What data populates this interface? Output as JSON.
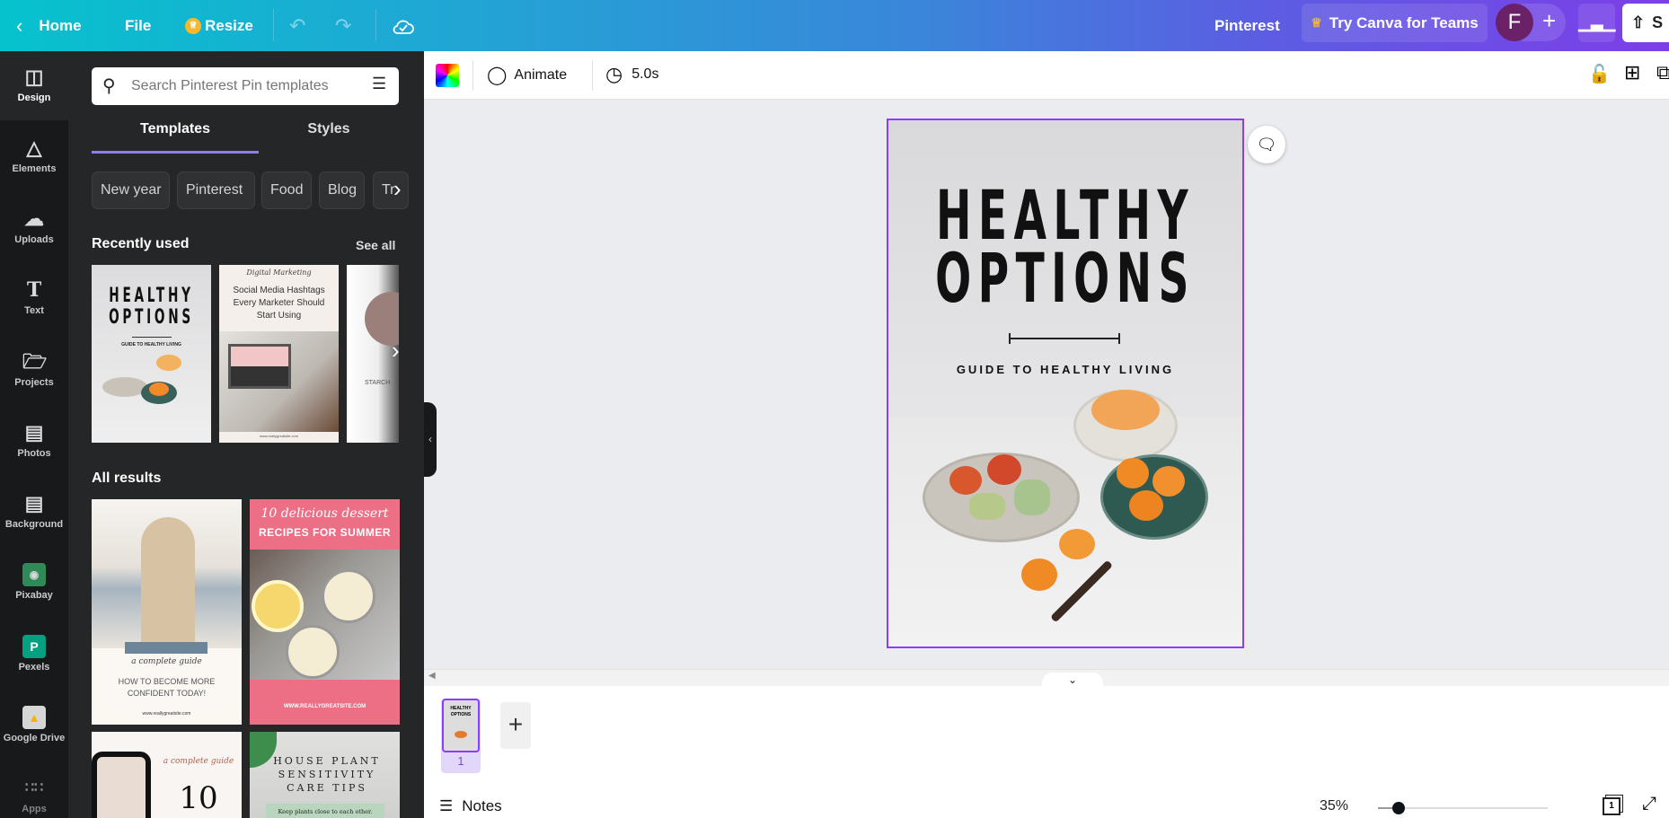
{
  "topbar": {
    "home": "Home",
    "file": "File",
    "resize": "Resize",
    "design_name": "Pinterest",
    "teams": "Try Canva for Teams",
    "avatar": "F",
    "share": "S"
  },
  "rail": [
    {
      "label": "Design",
      "icon": "design-icon"
    },
    {
      "label": "Elements",
      "icon": "elements-icon"
    },
    {
      "label": "Uploads",
      "icon": "upload-cloud-icon"
    },
    {
      "label": "Text",
      "icon": "text-icon"
    },
    {
      "label": "Projects",
      "icon": "folder-icon"
    },
    {
      "label": "Photos",
      "icon": "photo-icon"
    },
    {
      "label": "Background",
      "icon": "background-icon"
    },
    {
      "label": "Pixabay",
      "icon": "pixabay-icon"
    },
    {
      "label": "Pexels",
      "icon": "pexels-icon"
    },
    {
      "label": "Google Drive",
      "icon": "google-drive-icon"
    },
    {
      "label": "Apps",
      "icon": "apps-icon"
    }
  ],
  "panel": {
    "search_placeholder": "Search Pinterest Pin templates",
    "tabs": [
      "Templates",
      "Styles"
    ],
    "chips": [
      "New year",
      "Pinterest",
      "Food",
      "Blog",
      "Tr"
    ],
    "recent_title": "Recently used",
    "see_all": "See all",
    "recent": [
      {
        "title1": "HEALTHY",
        "title2": "OPTIONS",
        "sub": "GUIDE TO HEALTHY LIVING"
      },
      {
        "script": "Digital Marketing",
        "text": "Social Media Hashtags Every Marketer Should Start Using",
        "url": "www.reallygreatsite.com"
      },
      {
        "text": "STARCH"
      }
    ],
    "all_title": "All results",
    "results": [
      {
        "script": "a complete guide",
        "text": "HOW TO BECOME MORE CONFIDENT TODAY!",
        "url": "www.reallygreatsite.com"
      },
      {
        "script": "10 delicious dessert",
        "text": "RECIPES FOR SUMMER",
        "url": "WWW.REALLYGREATSITE.COM"
      },
      {
        "script": "a complete guide",
        "text": "10"
      },
      {
        "text": "HOUSE PLANT SENSITIVITY CARE TIPS",
        "sub": "Keep plants close to each other."
      }
    ]
  },
  "canvas_toolbar": {
    "animate": "Animate",
    "duration": "5.0s"
  },
  "page": {
    "title1": "HEALTHY",
    "title2": "OPTIONS",
    "subtitle": "GUIDE TO HEALTHY LIVING"
  },
  "bottom": {
    "page_number": "1",
    "notes": "Notes",
    "zoom": "35%",
    "zoom_value": 35,
    "page_count": "1"
  },
  "colors": {
    "accent": "#8b3dff",
    "panel": "#252627",
    "rail": "#18191b",
    "canvas_bg": "#ebecf0"
  }
}
